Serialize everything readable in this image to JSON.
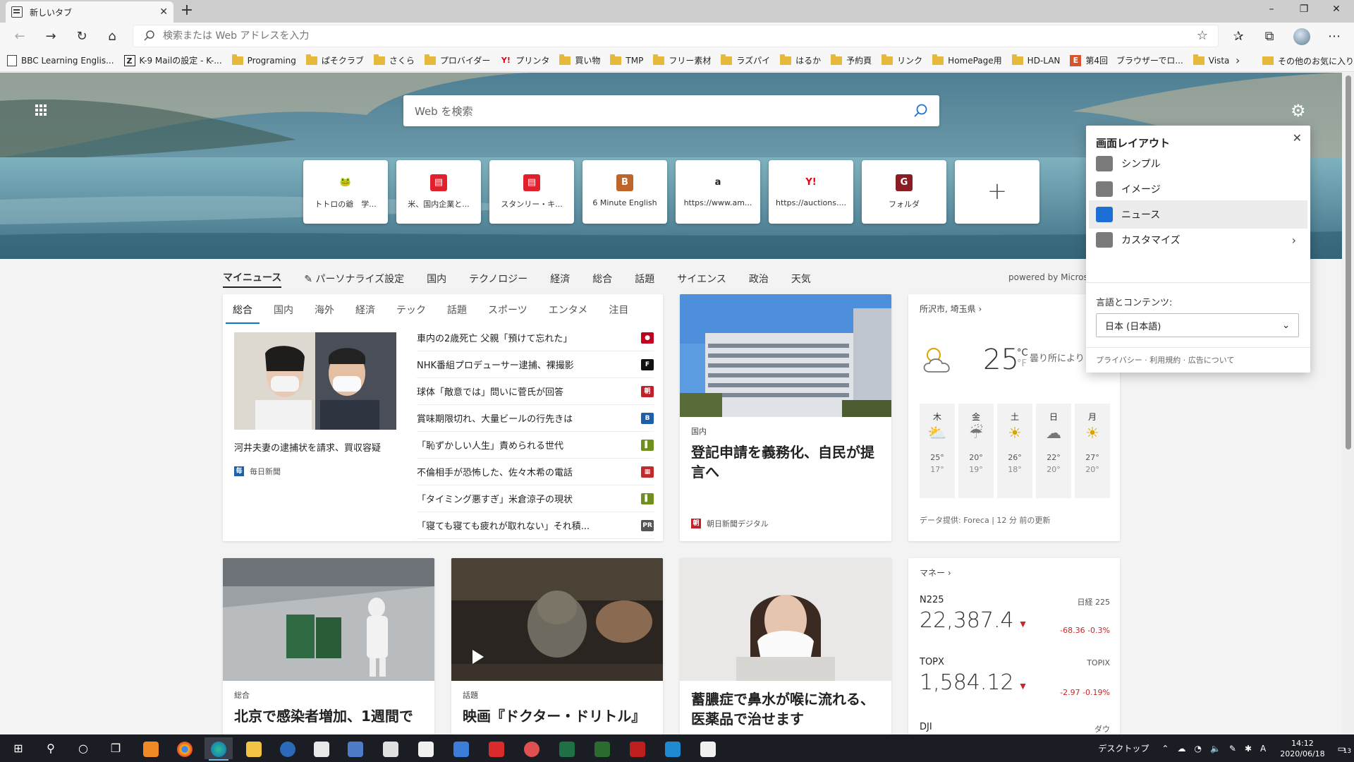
{
  "browser": {
    "tab_title": "新しいタブ",
    "tab_close": "✕",
    "new_tab": "+",
    "address_placeholder": "検索または Web アドレスを入力",
    "window_controls": [
      "–",
      "❐",
      "✕"
    ]
  },
  "bookmarks": {
    "items": [
      {
        "label": "BBC Learning Englis...",
        "icon": "page-icon"
      },
      {
        "label": "K-9 Mailの設定 - K-...",
        "icon": "z-site-icon"
      },
      {
        "label": "Programing",
        "icon": "folder-icon"
      },
      {
        "label": "ぱそクラブ",
        "icon": "folder-icon"
      },
      {
        "label": "さくら",
        "icon": "folder-icon"
      },
      {
        "label": "プロバイダー",
        "icon": "folder-icon"
      },
      {
        "label": "プリンタ",
        "icon": "yahoo-icon"
      },
      {
        "label": "買い物",
        "icon": "folder-icon"
      },
      {
        "label": "TMP",
        "icon": "folder-icon"
      },
      {
        "label": "フリー素材",
        "icon": "folder-icon"
      },
      {
        "label": "ラズパイ",
        "icon": "folder-icon"
      },
      {
        "label": "はるか",
        "icon": "folder-icon"
      },
      {
        "label": "予約頁",
        "icon": "folder-icon"
      },
      {
        "label": "リンク",
        "icon": "folder-icon"
      },
      {
        "label": "HomePage用",
        "icon": "folder-icon"
      },
      {
        "label": "HD-LAN",
        "icon": "folder-icon"
      },
      {
        "label": "第4回　ブラウザーでロ...",
        "icon": "site-icon"
      },
      {
        "label": "Vista",
        "icon": "folder-icon"
      }
    ],
    "more": "›",
    "other": "その他のお気に入り"
  },
  "newtab": {
    "search_placeholder": "Web を検索",
    "quick_links": [
      {
        "label": "トトロの爺　学...",
        "icon": "totoro-icon",
        "color": "#ffffff",
        "glyph": "🐸"
      },
      {
        "label": "米、国内企業と...",
        "icon": "news-icon",
        "color": "#e0202c",
        "glyph": "▤"
      },
      {
        "label": "スタンリー・キ...",
        "icon": "news-icon",
        "color": "#e0202c",
        "glyph": "▤"
      },
      {
        "label": "6 Minute English",
        "icon": "b-icon",
        "color": "#c0652a",
        "glyph": "B"
      },
      {
        "label": "https://www.am...",
        "icon": "amazon-icon",
        "color": "#ffffff",
        "glyph": "a"
      },
      {
        "label": "https://auctions....",
        "icon": "yahoo-icon",
        "color": "#ffffff",
        "glyph": "Y!"
      },
      {
        "label": "フォルダ",
        "icon": "g-icon",
        "color": "#8a1c24",
        "glyph": "G"
      }
    ],
    "add_label": "+",
    "categories": [
      "マイニュース",
      "パーソナライズ設定",
      "国内",
      "テクノロジー",
      "経済",
      "総合",
      "話題",
      "サイエンス",
      "政治",
      "天気"
    ],
    "powered_by": "powered by Microso"
  },
  "news": {
    "subtabs": [
      "総合",
      "国内",
      "海外",
      "経済",
      "テック",
      "話題",
      "スポーツ",
      "エンタメ",
      "注目"
    ],
    "lead_caption": "河井夫妻の逮捕状を請求、買収容疑",
    "lead_source": "毎日新聞",
    "headlines": [
      {
        "text": "車内の2歳死亡 父親「預けて忘れた」",
        "color": "#c00020",
        "glyph": "●"
      },
      {
        "text": "NHK番組プロデューサー逮捕、裸撮影",
        "color": "#111111",
        "glyph": "F"
      },
      {
        "text": "球体「敵意では」問いに菅氏が回答",
        "color": "#c0202a",
        "glyph": "朝"
      },
      {
        "text": "賞味期限切れ、大量ビールの行先きは",
        "color": "#1d5fa8",
        "glyph": "B"
      },
      {
        "text": "「恥ずかしい人生」責められる世代",
        "color": "#6f8f1f",
        "glyph": "▌"
      },
      {
        "text": "不倫相手が恐怖した、佐々木希の電話",
        "color": "#c02a2a",
        "glyph": "▦"
      },
      {
        "text": "「タイミング悪すぎ」米倉涼子の現状",
        "color": "#6f8f1f",
        "glyph": "▌"
      },
      {
        "text": "「寝ても寝ても疲れが取れない」それ積...",
        "color": "#555555",
        "glyph": "PR"
      }
    ]
  },
  "stories": [
    {
      "category": "国内",
      "title": "登記申請を義務化、自民が提言へ",
      "source": "朝日新聞デジタル"
    },
    {
      "category": "総合",
      "title": "北京で感染者増加、1週間で"
    },
    {
      "category": "話題",
      "title": "映画『ドクター・ドリトル』"
    },
    {
      "title": "蓄膿症で鼻水が喉に流れる、医薬品で治せます"
    }
  ],
  "weather": {
    "location": "所沢市, 埼玉県",
    "temp": "25",
    "unit": "°C",
    "unit_f": "°F",
    "condition": "曇り所により",
    "forecast": [
      {
        "day": "木",
        "icon": "rain-sun-icon",
        "glyph": "⛅",
        "high": "25°",
        "low": "17°"
      },
      {
        "day": "金",
        "icon": "rain-icon",
        "glyph": "☔",
        "high": "20°",
        "low": "19°"
      },
      {
        "day": "土",
        "icon": "sun-icon",
        "glyph": "☀",
        "high": "26°",
        "low": "18°"
      },
      {
        "day": "日",
        "icon": "cloud-icon",
        "glyph": "☁",
        "high": "22°",
        "low": "20°"
      },
      {
        "day": "月",
        "icon": "sun-icon",
        "glyph": "☀",
        "high": "27°",
        "low": "20°"
      }
    ],
    "provider": "データ提供: Foreca | 12 分 前の更新"
  },
  "money": {
    "title": "マネー",
    "items": [
      {
        "name": "N225",
        "name2": "日経 225",
        "value": "22,387.4",
        "change": "-68.36  -0.3%"
      },
      {
        "name": "TOPX",
        "name2": "TOPIX",
        "value": "1,584.12",
        "change": "-2.97  -0.19%"
      },
      {
        "name": "DJI",
        "name2": "ダウ"
      }
    ]
  },
  "layout_panel": {
    "title": "画面レイアウト",
    "close": "✕",
    "options": [
      {
        "label": "シンプル",
        "icon": "simple-layout-icon"
      },
      {
        "label": "イメージ",
        "icon": "image-layout-icon"
      },
      {
        "label": "ニュース",
        "icon": "news-layout-icon",
        "selected": true
      },
      {
        "label": "カスタマイズ",
        "icon": "customize-icon"
      }
    ],
    "language_label": "言語とコンテンツ:",
    "language_value": "日本 (日本語)",
    "footer": "プライバシー · 利用規約 · 広告について"
  },
  "taskbar": {
    "desktop_label": "デスクトップ",
    "time": "14:12",
    "date": "2020/06/18",
    "notif_count": "13"
  },
  "colors": {
    "accent": "#0078d4",
    "negative": "#c62828",
    "taskbar": "#1a1d24"
  }
}
